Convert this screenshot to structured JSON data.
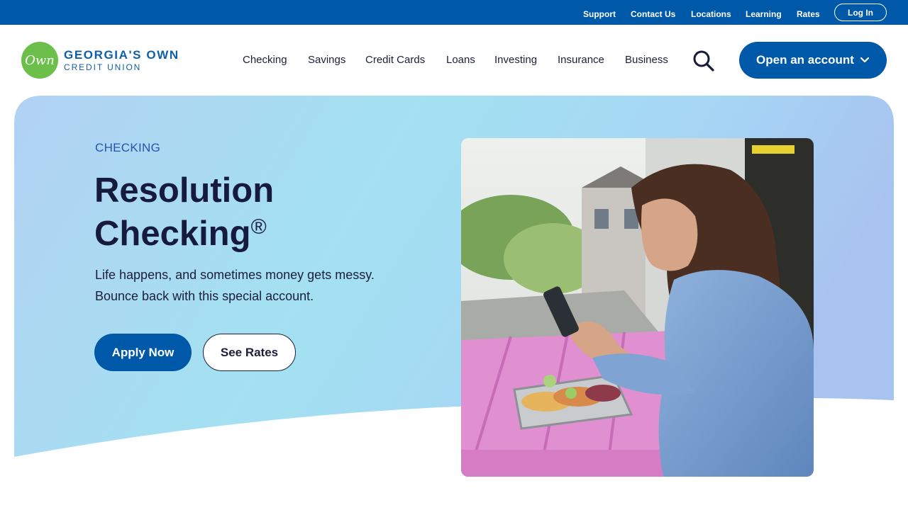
{
  "utility_nav": {
    "links": [
      "Support",
      "Contact Us",
      "Locations",
      "Learning",
      "Rates"
    ],
    "login_label": "Log In"
  },
  "brand": {
    "logo_mark": "Own",
    "name_line1": "GEORGIA'S OWN",
    "name_line2": "CREDIT UNION",
    "colors": {
      "primary": "#0058a8",
      "logo_green": "#6cbf4a",
      "dark_text": "#161b3d"
    }
  },
  "main_nav": {
    "items": [
      "Checking",
      "Savings",
      "Credit Cards",
      "Loans",
      "Investing",
      "Insurance",
      "Business"
    ],
    "search_icon": "search-icon",
    "cta_label": "Open an account",
    "cta_icon": "chevron-down-icon"
  },
  "hero": {
    "eyebrow": "CHECKING",
    "title": "Resolution Checking",
    "title_mark": "®",
    "description_line1": "Life happens, and sometimes money gets messy.",
    "description_line2": "Bounce back with this special account.",
    "apply_label": "Apply Now",
    "rates_label": "See Rates",
    "photo_subject": "woman-using-phone-at-pink-picnic-table"
  }
}
